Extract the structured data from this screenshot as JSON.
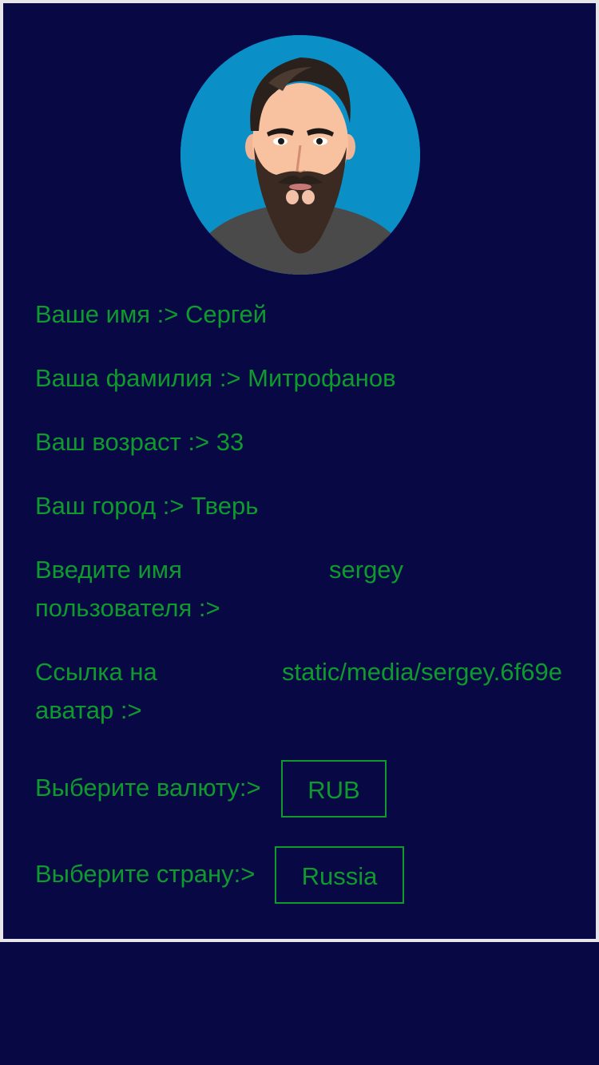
{
  "profile": {
    "avatar_icon": "bearded-man-avatar",
    "first_name_label": "Ваше имя :>",
    "first_name_value": "Сергей",
    "last_name_label": "Ваша фамилия :>",
    "last_name_value": "Митрофанов",
    "age_label": "Ваш возраст :>",
    "age_value": "33",
    "city_label": "Ваш город :>",
    "city_value": "Тверь",
    "username_label": "Введите имя пользователя :>",
    "username_value": "sergey",
    "avatar_link_label": "Ссылка на аватар :>",
    "avatar_link_value": "static/media/sergey.6f69e",
    "currency_label": "Выберите валюту:>",
    "currency_value": "RUB",
    "country_label": "Выберите страну:>",
    "country_value": "Russia"
  },
  "colors": {
    "background": "#080845",
    "text": "#0f9a2d",
    "border": "#e6e6ea",
    "avatar_bg": "#0a8fc7"
  }
}
